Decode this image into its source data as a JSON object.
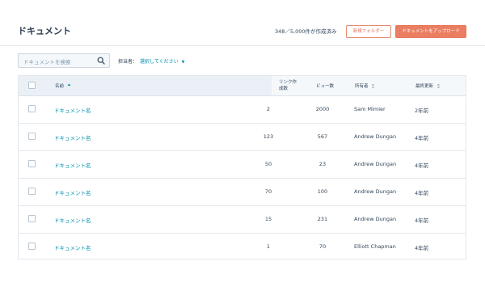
{
  "header": {
    "title": "ドキュメント",
    "usage": "348／5,000件が作成済み",
    "new_folder_button": "新規フォルダー",
    "upload_button": "ドキュメントをアップロード"
  },
  "toolbar": {
    "search_placeholder": "ドキュメントを検索",
    "owner_label": "担当者：",
    "owner_select": "選択してください"
  },
  "table": {
    "columns": {
      "name": "名前",
      "links_line1": "リンク作",
      "links_line2": "成数",
      "views": "ビュー数",
      "owner": "所有者",
      "updated": "最終更新"
    },
    "rows": [
      {
        "name": "ドキュメント名",
        "links": "2",
        "views": "2000",
        "owner": "Sam Mimier",
        "updated": "2年前"
      },
      {
        "name": "ドキュメント名",
        "links": "123",
        "views": "567",
        "owner": "Andrew Dungan",
        "updated": "4年前"
      },
      {
        "name": "ドキュメント名",
        "links": "50",
        "views": "23",
        "owner": "Andrew Dungan",
        "updated": "4年前"
      },
      {
        "name": "ドキュメント名",
        "links": "70",
        "views": "100",
        "owner": "Andrew Dungan",
        "updated": "4年前"
      },
      {
        "name": "ドキュメント名",
        "links": "15",
        "views": "231",
        "owner": "Andrew Dungan",
        "updated": "4年前"
      },
      {
        "name": "ドキュメント名",
        "links": "1",
        "views": "70",
        "owner": "Elliott Chapman",
        "updated": "4年前"
      }
    ]
  },
  "colors": {
    "accent": "#eb7e62",
    "link": "#0091ae",
    "text": "#33475b"
  }
}
